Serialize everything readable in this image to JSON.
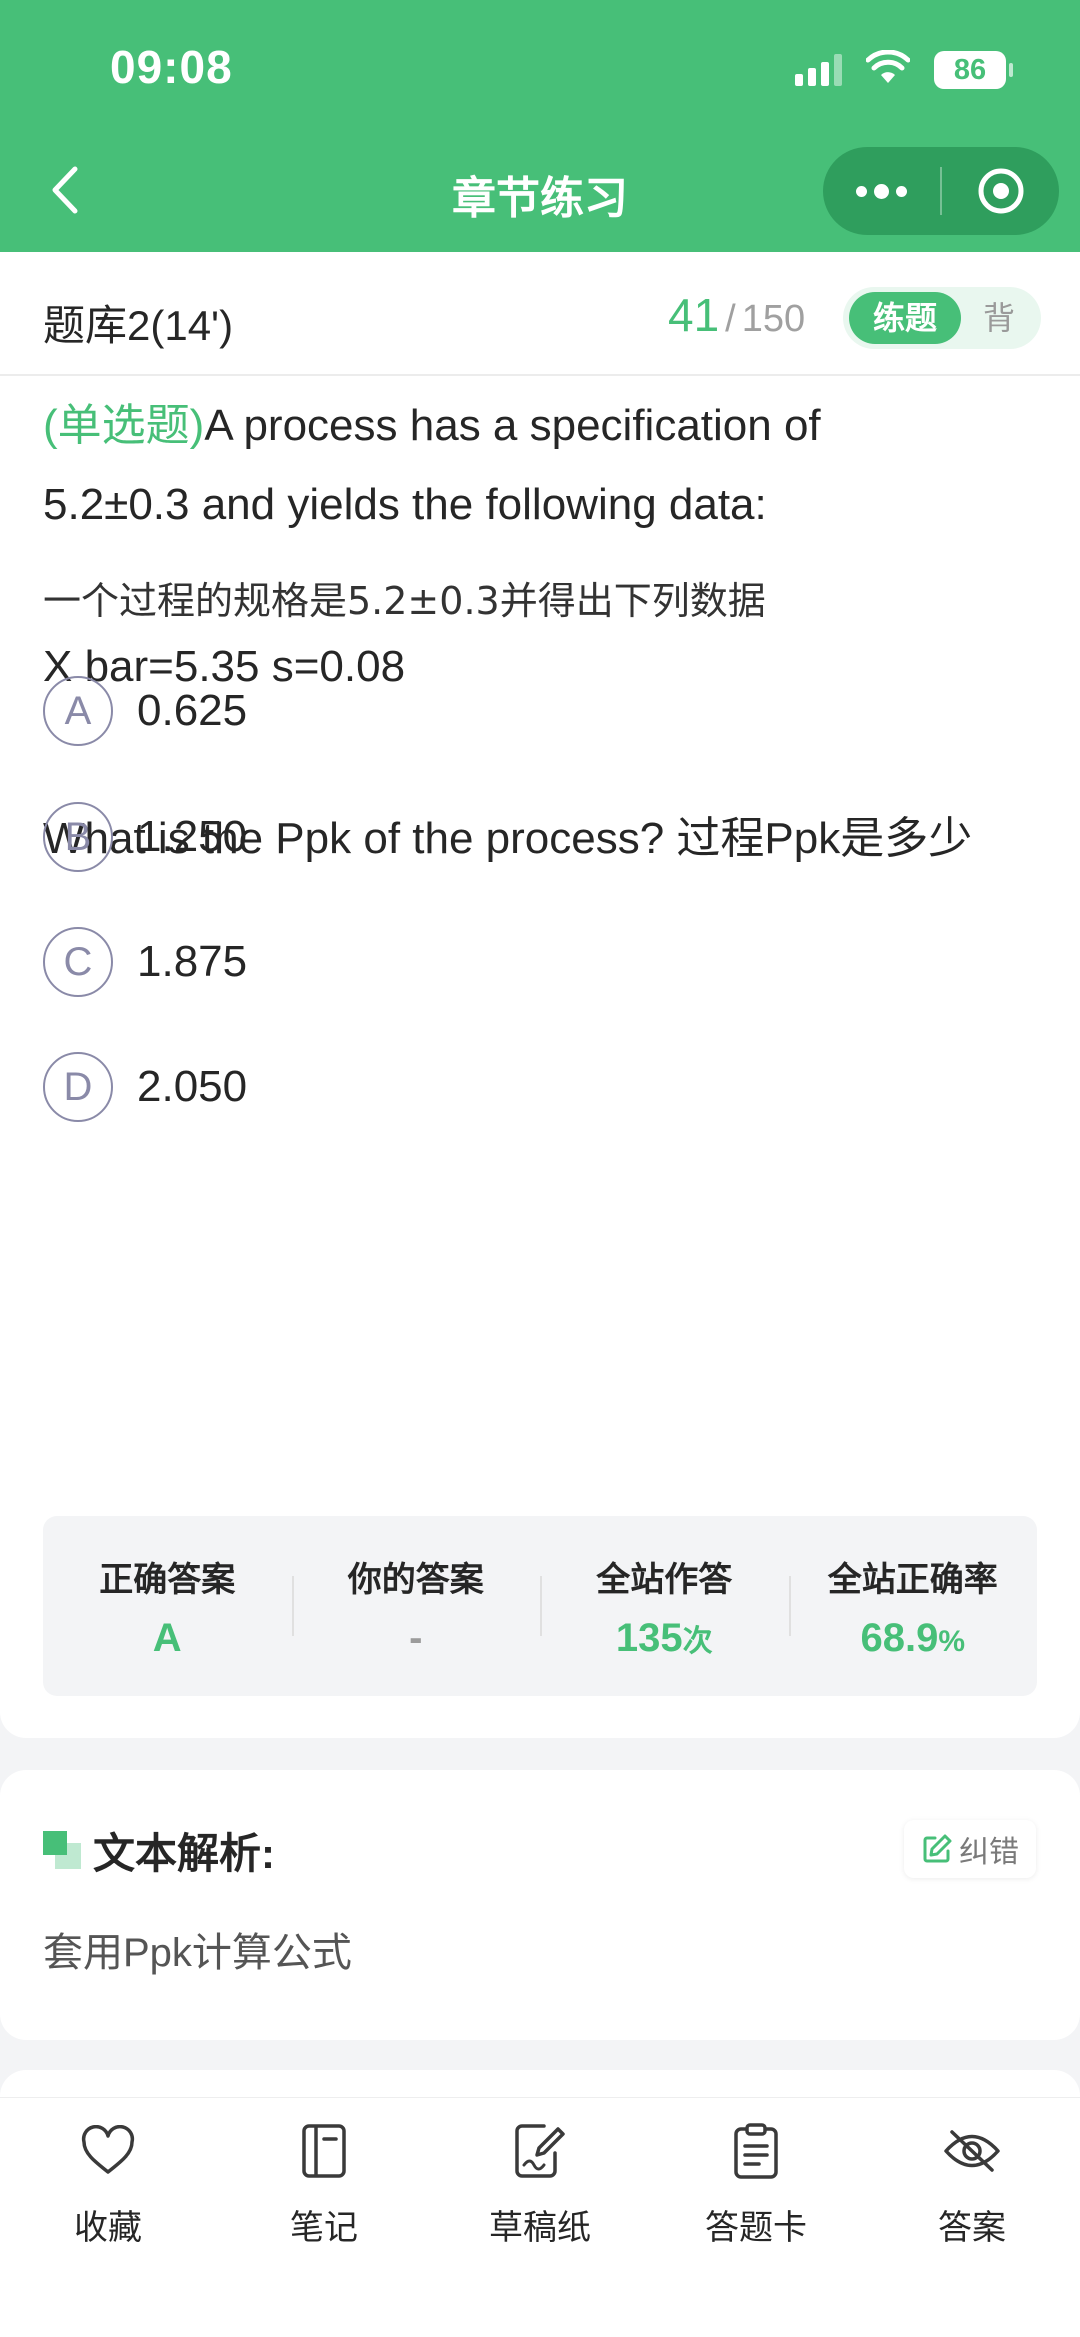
{
  "status_bar": {
    "time": "09:08",
    "battery": "86"
  },
  "nav": {
    "title": "章节练习"
  },
  "bank": {
    "name": "题库2(14')",
    "current": "41",
    "separator": "/",
    "total": "150",
    "mode_active": "练题",
    "mode_inactive": "背"
  },
  "question": {
    "type_tag": "(单选题)",
    "line1": "A process has a specification of",
    "line2": "5.2±0.3 and yields the following data:",
    "line_cn": "一个过程的规格是5.2±0.3并得出下列数据",
    "line3": "X bar=5.35 s=0.08",
    "line4": "What is the Ppk of the process? 过程Ppk是多少",
    "options": [
      {
        "key": "A",
        "text": "0.625"
      },
      {
        "key": "B",
        "text": "1.250"
      },
      {
        "key": "C",
        "text": "1.875"
      },
      {
        "key": "D",
        "text": "2.050"
      }
    ]
  },
  "stats": {
    "correct_label": "正确答案",
    "correct_value": "A",
    "yours_label": "你的答案",
    "yours_value": "-",
    "attempts_label": "全站作答",
    "attempts_value": "135",
    "attempts_unit": "次",
    "rate_label": "全站正确率",
    "rate_value": "68.9",
    "rate_unit": "%"
  },
  "analysis": {
    "title": "文本解析:",
    "correct_button": "纠错",
    "body": "套用Ppk计算公式"
  },
  "bottom_tabs": [
    {
      "label": "收藏",
      "icon": "heart-icon"
    },
    {
      "label": "笔记",
      "icon": "notebook-icon"
    },
    {
      "label": "草稿纸",
      "icon": "draft-icon"
    },
    {
      "label": "答题卡",
      "icon": "clipboard-icon"
    },
    {
      "label": "答案",
      "icon": "eye-off-icon"
    }
  ],
  "colors": {
    "brand": "#47bf78",
    "brand_dark": "#2f9e5d",
    "option_ring": "#8a8aa8"
  }
}
